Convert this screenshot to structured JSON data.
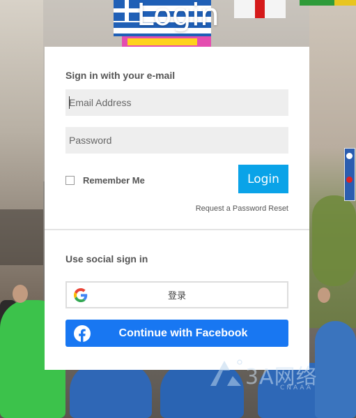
{
  "page": {
    "title": "Login"
  },
  "email_section": {
    "title": "Sign in with your e-mail",
    "email_placeholder": "Email Address",
    "password_placeholder": "Password",
    "remember_label": "Remember Me",
    "remember_checked": false,
    "login_label": "Login",
    "reset_label": "Request a Password Reset"
  },
  "social_section": {
    "title": "Use social sign in",
    "google_label": "登录",
    "facebook_label": "Continue with Facebook"
  },
  "watermark": {
    "text": "3A网络",
    "subtext": "CNAAA"
  },
  "colors": {
    "login_button": "#0aa3e8",
    "facebook_button": "#1877f2",
    "input_background": "#eeeeee"
  },
  "icons": {
    "google": "google-g-logo",
    "facebook": "facebook-f-logo"
  }
}
